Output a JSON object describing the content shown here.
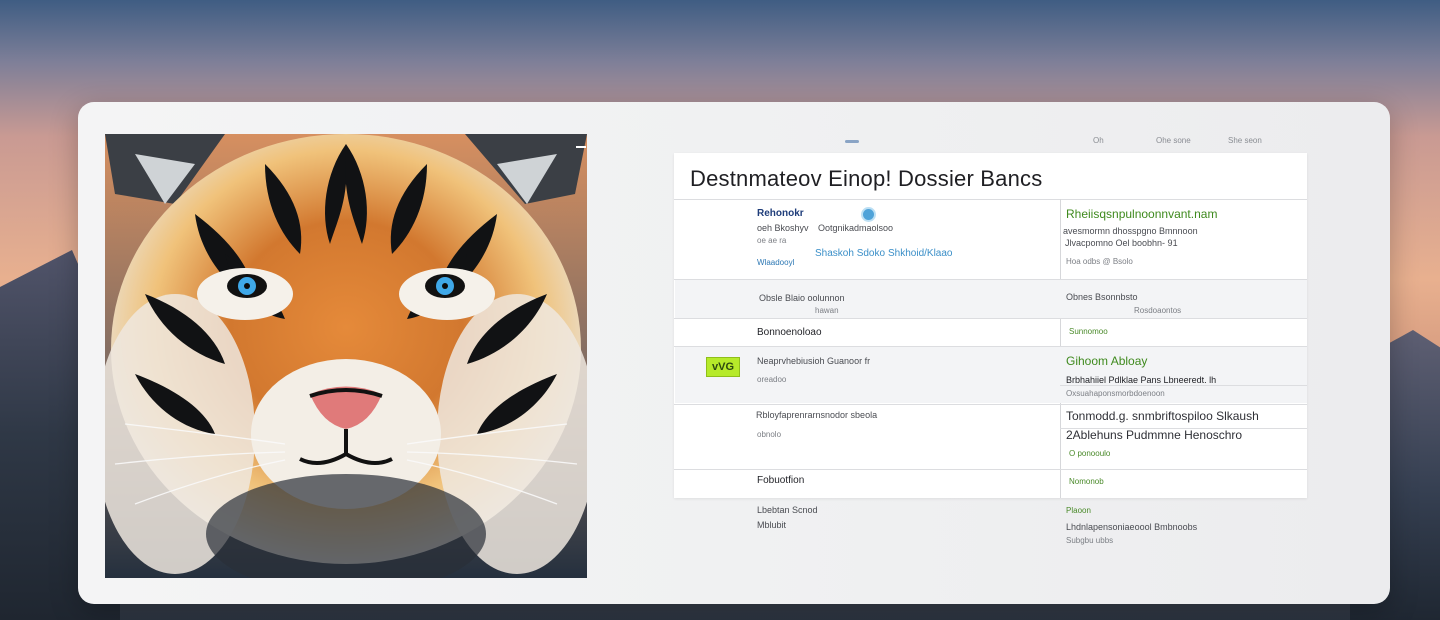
{
  "top_right_menu": [
    "Oh",
    "Ohe sone",
    "She seon"
  ],
  "panel": {
    "title": "Destnmateov Einop! Dossier Bancs",
    "left_rows": [
      {
        "line1": "Rehonokr",
        "line2": "oeh Bkoshyv",
        "line2b": "Ootgnikadmaolsoo",
        "line3": "oe ae ra",
        "line4_links": [
          "Shaskoh Sdoko",
          "Shkhoid/Klaao"
        ],
        "line5": "Wlaadooyl"
      },
      {
        "line1": "Obsle Blaio oolunnon",
        "line2": "hawan"
      },
      {
        "line1": "Bonnoenoloao"
      },
      {
        "badge": "vVG",
        "line1": "Neaprvhebiusioh Guanoor fr",
        "line2": "oreadoo"
      },
      {
        "line1": "Rbloyfaprenrarnsnodor sbeola",
        "line2": "obnolo"
      },
      {
        "line1": "Fobuotfion"
      }
    ],
    "right_rows": [
      {
        "head": "Rheiisqsnpulnoonnvant.nam",
        "line2": "avesmormn dhosspgno Bmnnoon",
        "line3": "Jlvacpomno Oel boobhn- 91",
        "line4": "Hoa odbs @ Bsolo"
      },
      {
        "line1": "Obnes Bsonnbsto",
        "line2": "Rosdoaontos"
      },
      {
        "line1": "Sunnomoo"
      },
      {
        "head": "Gihoom Abloay",
        "line2": "Brbhahiiel Pdlklae Pans Lbneeredt. lh",
        "line3": "Oxsuahaponsmorbdoenoon"
      },
      {
        "line1": "Tonmodd.g. snmbriftospiloo Slkaush",
        "line2": "2Ablehuns Pudmmne Henoschro",
        "line3": "O ponooulo"
      },
      {
        "line1": "Nomonob"
      }
    ]
  },
  "below_panel": {
    "left": [
      "Lbebtan Scnod",
      "Mblubit"
    ],
    "right": [
      "Plaoon",
      "Lhdnlapensoniaeoool Bmbnoobs",
      "Subgbu ubbs"
    ]
  },
  "colors": {
    "accent_blue": "#2d78b4",
    "accent_green": "#4a8a2a",
    "badge_green": "#b6ea2a"
  }
}
